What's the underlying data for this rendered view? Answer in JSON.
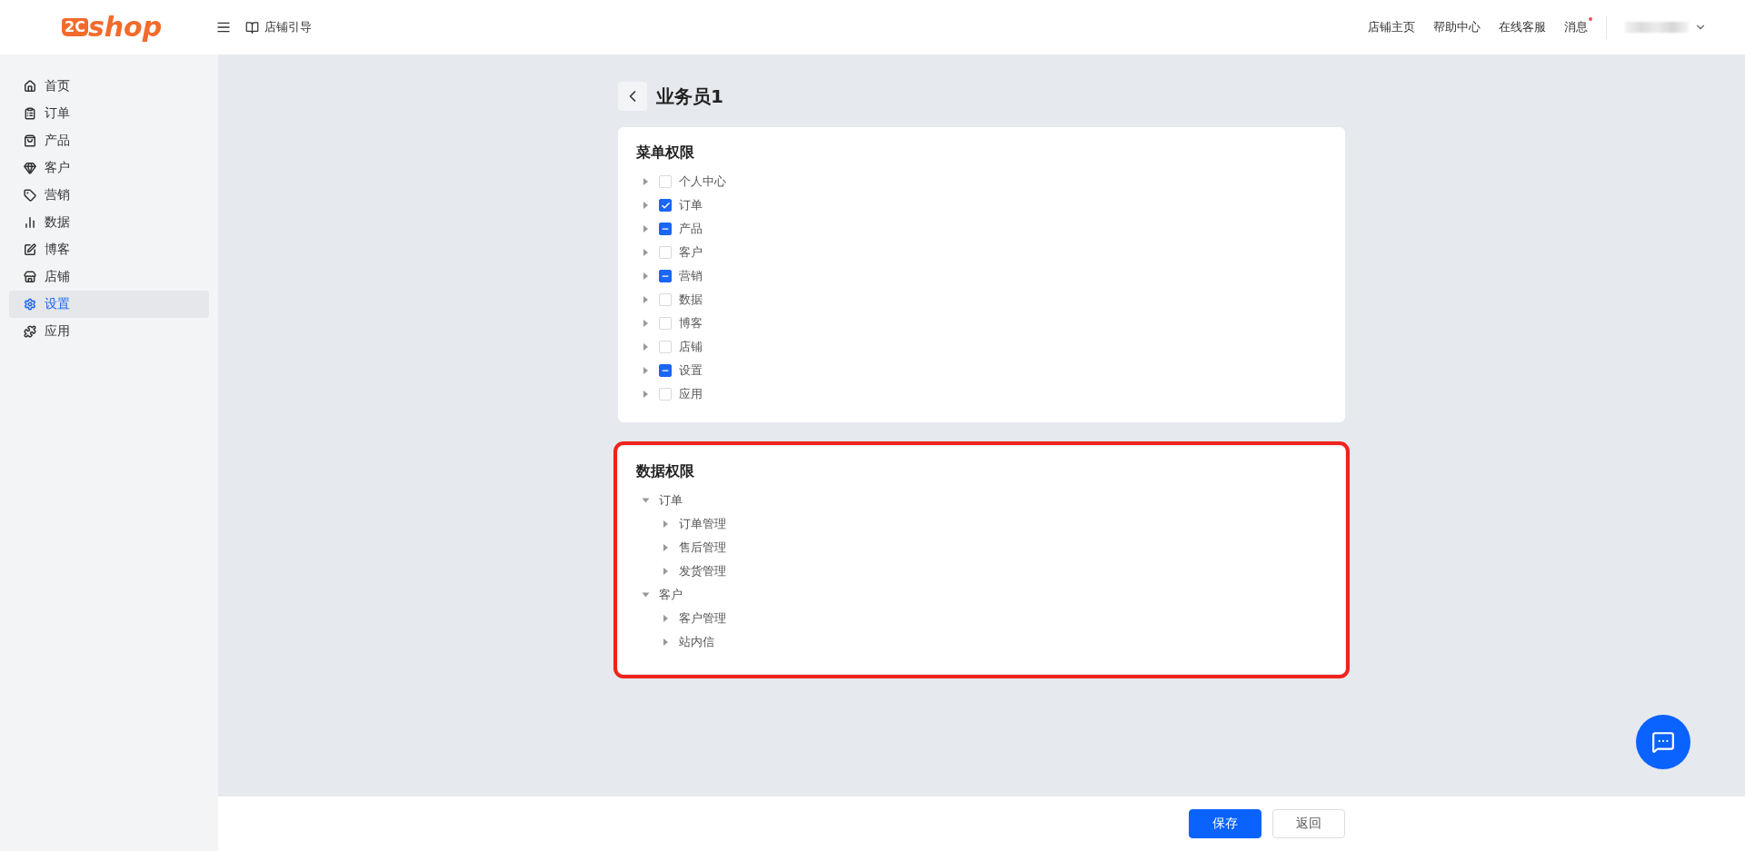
{
  "header": {
    "logo_mark": "2C",
    "logo_text": "shop",
    "guide": "店铺引导",
    "links": [
      "店铺主页",
      "帮助中心",
      "在线客服"
    ],
    "messages": {
      "label": "消息",
      "unread": true
    }
  },
  "sidebar": {
    "items": [
      {
        "label": "首页",
        "selected": false
      },
      {
        "label": "订单",
        "selected": false
      },
      {
        "label": "产品",
        "selected": false
      },
      {
        "label": "客户",
        "selected": false
      },
      {
        "label": "营销",
        "selected": false
      },
      {
        "label": "数据",
        "selected": false
      },
      {
        "label": "博客",
        "selected": false
      },
      {
        "label": "店铺",
        "selected": false
      },
      {
        "label": "设置",
        "selected": true
      },
      {
        "label": "应用",
        "selected": false
      }
    ]
  },
  "page": {
    "title": "业务员1"
  },
  "menu_permissions": {
    "title": "菜单权限",
    "items": [
      {
        "label": "个人中心",
        "kind": "full",
        "checked": false
      },
      {
        "label": "订单",
        "kind": "full",
        "checked": true
      },
      {
        "label": "产品",
        "kind": "partial",
        "checked": true
      },
      {
        "label": "客户",
        "kind": "full",
        "checked": false
      },
      {
        "label": "营销",
        "kind": "partial",
        "checked": true
      },
      {
        "label": "数据",
        "kind": "full",
        "checked": false
      },
      {
        "label": "博客",
        "kind": "full",
        "checked": false
      },
      {
        "label": "店铺",
        "kind": "full",
        "checked": false
      },
      {
        "label": "设置",
        "kind": "partial",
        "checked": true
      },
      {
        "label": "应用",
        "kind": "full",
        "checked": false
      }
    ]
  },
  "data_permissions": {
    "title": "数据权限",
    "highlighted": true,
    "items": [
      {
        "label": "订单",
        "expanded": true,
        "children": [
          {
            "label": "订单管理",
            "expanded": false
          },
          {
            "label": "售后管理",
            "expanded": false
          },
          {
            "label": "发货管理",
            "expanded": false
          }
        ]
      },
      {
        "label": "客户",
        "expanded": true,
        "children": [
          {
            "label": "客户管理",
            "expanded": false
          },
          {
            "label": "站内信",
            "expanded": false
          }
        ]
      }
    ]
  },
  "footer": {
    "buttons": [
      {
        "label": "保存",
        "kind": "primary"
      },
      {
        "label": "返回",
        "kind": "default"
      }
    ]
  }
}
